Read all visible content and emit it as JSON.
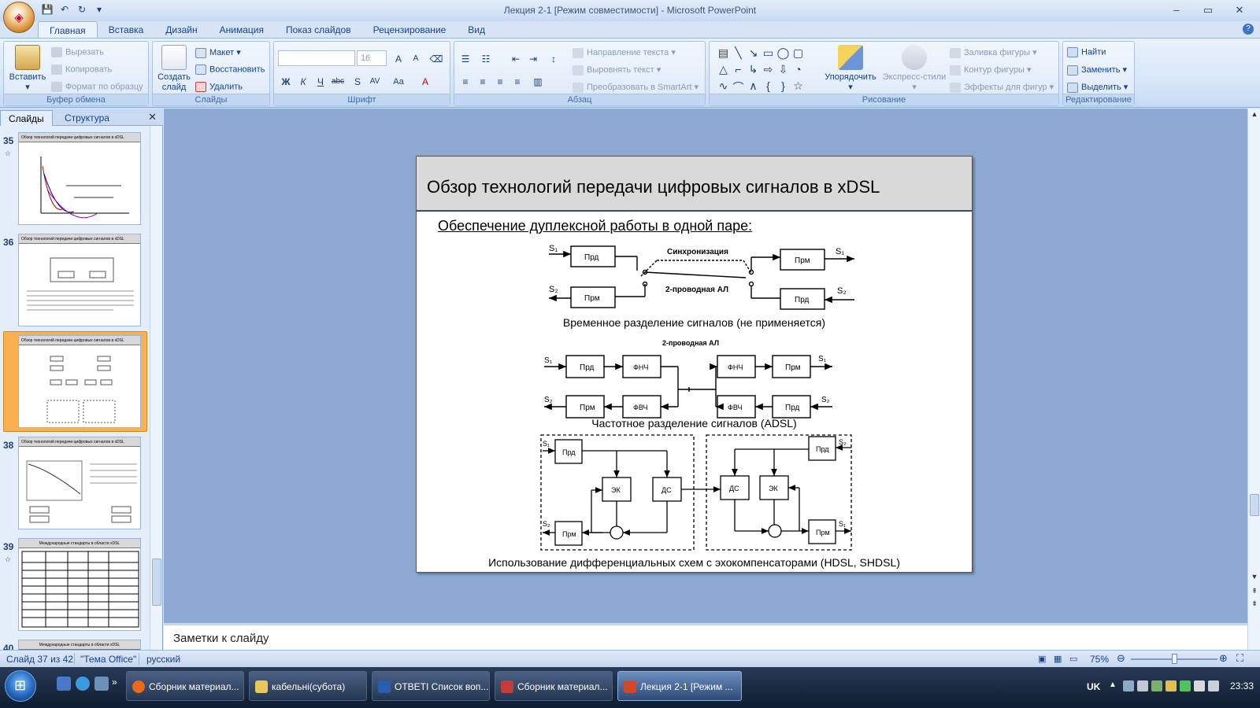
{
  "window": {
    "title": "Лекция 2-1 [Режим совместимости] - Microsoft PowerPoint",
    "controls": [
      "–",
      "▭",
      "✕"
    ]
  },
  "ribbon_tabs": [
    "Главная",
    "Вставка",
    "Дизайн",
    "Анимация",
    "Показ слайдов",
    "Рецензирование",
    "Вид"
  ],
  "ribbon": {
    "clipboard": {
      "label": "Буфер обмена",
      "paste": "Вставить",
      "cut": "Вырезать",
      "copy": "Копировать",
      "format_painter": "Формат по образцу"
    },
    "slides": {
      "label": "Слайды",
      "new_slide": "Создать слайд",
      "layout": "Макет",
      "reset": "Восстановить",
      "delete": "Удалить"
    },
    "font": {
      "label": "Шрифт",
      "font_name": "",
      "font_size": "16"
    },
    "paragraph": {
      "label": "Абзац",
      "text_direction": "Направление текста",
      "align_text": "Выровнять текст",
      "convert_smartart": "Преобразовать в SmartArt"
    },
    "drawing": {
      "label": "Рисование",
      "arrange": "Упорядочить",
      "quick_styles": "Экспресс-стили",
      "shape_fill": "Заливка фигуры",
      "shape_outline": "Контур фигуры",
      "shape_effects": "Эффекты для фигур"
    },
    "editing": {
      "label": "Редактирование",
      "find": "Найти",
      "replace": "Заменить",
      "select": "Выделить"
    }
  },
  "left_pane": {
    "tabs": [
      "Слайды",
      "Структура"
    ],
    "thumbnails": [
      {
        "num": "35",
        "title": "Обзор технологий передачи цифровых сигналов в xDSL"
      },
      {
        "num": "36",
        "title": "Обзор технологий передачи цифровых сигналов в xDSL"
      },
      {
        "num": "37",
        "title": "Обзор технологий передачи цифровых сигналов в xDSL"
      },
      {
        "num": "38",
        "title": "Обзор технологий передачи цифровых сигналов в xDSL"
      },
      {
        "num": "39",
        "title": "Международные стандарты в области xDSL"
      },
      {
        "num": "40",
        "title": "Международные стандарты в области xDSL"
      }
    ]
  },
  "slide": {
    "title": "Обзор технологий передачи цифровых сигналов в xDSL",
    "subtitle": "Обеспечение дуплексной работы в одной паре:",
    "caption1": "Временное разделение сигналов (не применяется)",
    "caption2": "Частотное разделение сигналов (ADSL)",
    "caption3": "Использование дифференциальных схем с эхокомпенсаторами (HDSL, SHDSL)",
    "d1": {
      "prd": "Прд",
      "prm": "Прм",
      "sync": "Синхронизация",
      "line": "2-проводная АЛ",
      "s1": "S₁",
      "s2": "S₂"
    },
    "d2": {
      "line": "2-проводная АЛ",
      "prd": "Прд",
      "prm": "Прм",
      "lpf": "ФНЧ",
      "hpf": "ФВЧ",
      "s1": "S₁",
      "s2": "S₂"
    },
    "d3": {
      "prd": "Прд",
      "prm": "Прм",
      "ek": "ЭК",
      "ds": "ДС",
      "s1": "S₁",
      "s2": "S₂"
    }
  },
  "notes": {
    "placeholder": "Заметки к слайду"
  },
  "status": {
    "slide": "Слайд 37 из 42",
    "theme": "\"Тема Office\"",
    "lang": "русский",
    "zoom": "75%"
  },
  "taskbar": {
    "buttons": [
      "Сборник материал...",
      "кабельні(субота)",
      "ОТВЕТІ Список воп...",
      "Сборник материал...",
      "Лекция 2-1 [Режим ..."
    ],
    "lang": "UK",
    "clock": "23:33"
  }
}
